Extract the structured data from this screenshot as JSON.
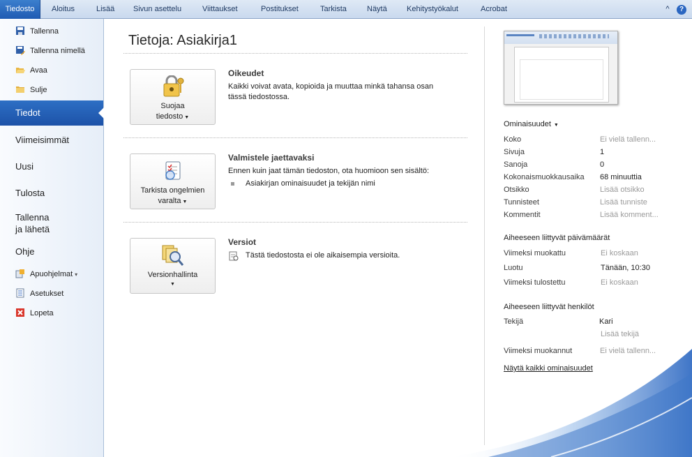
{
  "ribbon": {
    "tabs": [
      "Tiedosto",
      "Aloitus",
      "Lisää",
      "Sivun asettelu",
      "Viittaukset",
      "Postitukset",
      "Tarkista",
      "Näytä",
      "Kehitystyökalut",
      "Acrobat"
    ]
  },
  "nav": {
    "save": "Tallenna",
    "save_as": "Tallenna nimellä",
    "open": "Avaa",
    "close": "Sulje",
    "info": "Tiedot",
    "recent": "Viimeisimmät",
    "new": "Uusi",
    "print": "Tulosta",
    "save_send_1": "Tallenna",
    "save_send_2": "ja lähetä",
    "help": "Ohje",
    "addins": "Apuohjelmat",
    "options": "Asetukset",
    "exit": "Lopeta"
  },
  "main": {
    "title": "Tietoja: Asiakirja1",
    "permissions": {
      "button_line1": "Suojaa",
      "button_line2": "tiedosto",
      "heading": "Oikeudet",
      "text_line1": "Kaikki voivat avata, kopioida ja muuttaa minkä tahansa osan",
      "text_line2": "tässä tiedostossa."
    },
    "prepare": {
      "button_line1": "Tarkista ongelmien",
      "button_line2": "varalta",
      "heading": "Valmistele jaettavaksi",
      "text": "Ennen kuin jaat tämän tiedoston, ota huomioon sen sisältö:",
      "bullet": "Asiakirjan ominaisuudet ja tekijän nimi"
    },
    "versions": {
      "button_line1": "Versionhallinta",
      "heading": "Versiot",
      "text": "Tästä tiedostosta ei ole aikaisempia versioita."
    }
  },
  "properties": {
    "heading": "Ominaisuudet",
    "rows": [
      {
        "label": "Koko",
        "value": "Ei vielä tallenn..."
      },
      {
        "label": "Sivuja",
        "value": "1"
      },
      {
        "label": "Sanoja",
        "value": "0"
      },
      {
        "label": "Kokonaismuokkausaika",
        "value": "68 minuuttia"
      },
      {
        "label": "Otsikko",
        "value": "Lisää otsikko"
      },
      {
        "label": "Tunnisteet",
        "value": "Lisää tunniste"
      },
      {
        "label": "Kommentit",
        "value": "Lisää komment..."
      }
    ],
    "dates_heading": "Aiheeseen liittyvät päivämäärät",
    "dates": [
      {
        "label": "Viimeksi muokattu",
        "value": "Ei koskaan"
      },
      {
        "label": "Luotu",
        "value": "Tänään, 10:30"
      },
      {
        "label": "Viimeksi tulostettu",
        "value": "Ei koskaan"
      }
    ],
    "people_heading": "Aiheeseen liittyvät henkilöt",
    "author_label": "Tekijä",
    "author_value": "Kari",
    "add_author": "Lisää tekijä",
    "last_modified_by_label": "Viimeksi muokannut",
    "last_modified_by_value": "Ei vielä tallenn...",
    "show_all": "Näytä kaikki ominaisuudet"
  },
  "colors": {
    "accent": "#1f5bb3",
    "nav_selected": "#2d6fc4"
  }
}
